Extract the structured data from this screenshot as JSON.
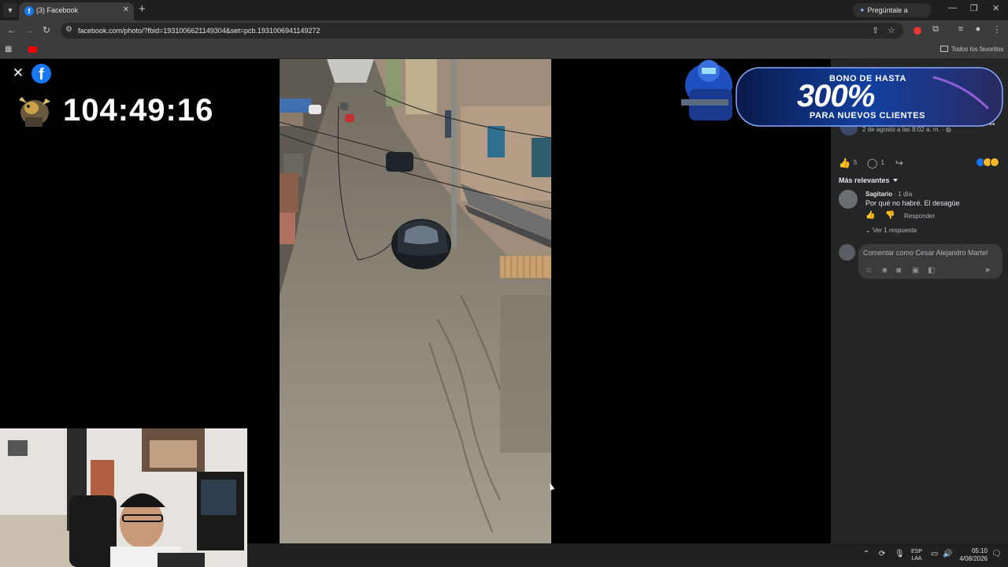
{
  "browser": {
    "tab_title": "(3) Facebook",
    "tab_close": "✕",
    "new_tab": "+",
    "gemini_label": "Pregúntale a Gemini",
    "url": "facebook.com/photo/?fbid=1931006621149304&set=pcb.1931006941149272",
    "bookmarks_all": "Todos los favoritos"
  },
  "overlay": {
    "timer": "104:49:16",
    "close": "✕",
    "fb_logo": "f"
  },
  "ad": {
    "line1": "BONO DE HASTA",
    "line2": "300%",
    "line3": "PARA NUEVOS CLIENTES"
  },
  "post": {
    "date": "2 de agosto a las 8:02 a. m. · ",
    "likes": "5",
    "comments": "1",
    "sort_label": "Más relevantes",
    "comment": {
      "author": "Sagitario",
      "time": " · 1 día",
      "text": "Por qué no habré. El desagüe",
      "reply": "Responder",
      "view_replies": "Ver 1 respuesta"
    },
    "composer_placeholder": "Comentar como Cesar Alejandro Martel"
  },
  "taskbar": {
    "lang1": "ESP",
    "lang2": "LAA",
    "time": "05:10",
    "date": "4/08/2026"
  },
  "colors": {
    "facebook_blue": "#1877f2",
    "panel_bg": "#242526",
    "chrome_bg": "#3c3c3c"
  },
  "icons": [
    "close-icon",
    "facebook-logo-icon",
    "back-icon",
    "forward-icon",
    "reload-icon",
    "star-icon",
    "extensions-icon",
    "like-icon",
    "comment-icon",
    "share-icon",
    "chevron-down-icon"
  ]
}
